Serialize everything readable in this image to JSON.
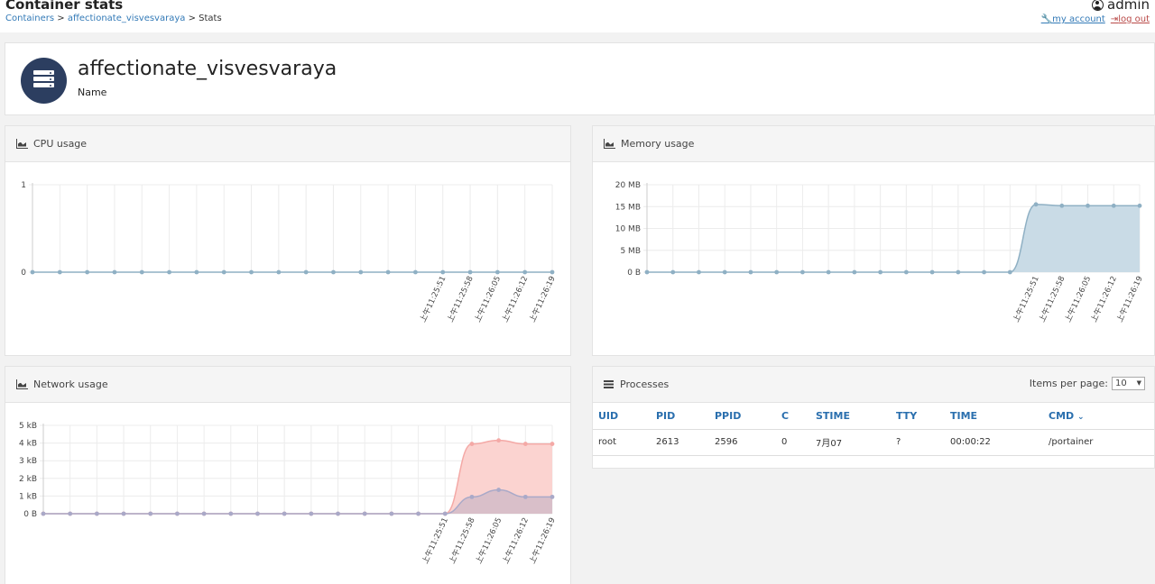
{
  "header": {
    "title": "Container stats",
    "breadcrumb": {
      "containers": "Containers",
      "container": "affectionate_visvesvaraya",
      "current": "Stats",
      "sep": ">"
    },
    "user": "admin",
    "my_account": "my account",
    "log_out": "log out"
  },
  "container": {
    "name": "affectionate_visvesvaraya",
    "name_label": "Name",
    "avatar_icon": "server-icon"
  },
  "panels": {
    "cpu": "CPU usage",
    "memory": "Memory usage",
    "network": "Network usage",
    "processes": "Processes"
  },
  "processes": {
    "items_per_page_label": "Items per page:",
    "items_per_page": "10",
    "columns": [
      "UID",
      "PID",
      "PPID",
      "C",
      "STIME",
      "TTY",
      "TIME",
      "CMD"
    ],
    "sort_indicator": "chevron-down-icon",
    "rows": [
      [
        "root",
        "2613",
        "2596",
        "0",
        "7月07",
        "?",
        "00:00:22",
        "/portainer"
      ]
    ]
  },
  "chart_data": [
    {
      "type": "line",
      "title": "CPU usage",
      "yticks": [
        "0",
        "1"
      ],
      "ylim": [
        0,
        1
      ],
      "xticks": [
        "上午11:25:51",
        "上午11:25:58",
        "上午11:26:05",
        "上午11:26:12",
        "上午11:26:19"
      ],
      "series": [
        {
          "values": [
            0,
            0,
            0,
            0,
            0,
            0,
            0,
            0,
            0,
            0,
            0,
            0,
            0,
            0,
            0,
            0,
            0,
            0,
            0,
            0
          ],
          "color": "#8fb0c4"
        }
      ]
    },
    {
      "type": "area",
      "title": "Memory usage",
      "yticks": [
        "0 B",
        "5 MB",
        "10 MB",
        "15 MB",
        "20 MB"
      ],
      "ylim": [
        0,
        20
      ],
      "xticks": [
        "上午11:25:51",
        "上午11:25:58",
        "上午11:26:05",
        "上午11:26:12",
        "上午11:26:19"
      ],
      "series": [
        {
          "values": [
            0,
            0,
            0,
            0,
            0,
            0,
            0,
            0,
            0,
            0,
            0,
            0,
            0,
            0,
            0,
            15.5,
            15.2,
            15.2,
            15.2,
            15.2
          ],
          "color": "#8fb0c4",
          "fill": "#c9dbe6"
        }
      ]
    },
    {
      "type": "area",
      "title": "Network usage",
      "yticks": [
        "0 B",
        "1 kB",
        "2 kB",
        "3 kB",
        "4 kB",
        "5 kB"
      ],
      "ylim": [
        0,
        5
      ],
      "xticks": [
        "上午11:25:51",
        "上午11:25:58",
        "上午11:26:05",
        "上午11:26:12",
        "上午11:26:19"
      ],
      "series": [
        {
          "values": [
            0,
            0,
            0,
            0,
            0,
            0,
            0,
            0,
            0,
            0,
            0,
            0,
            0,
            0,
            0,
            0,
            3.95,
            4.15,
            3.95,
            3.95
          ],
          "color": "#f4a9a6",
          "fill": "#fbd3d0"
        },
        {
          "values": [
            0,
            0,
            0,
            0,
            0,
            0,
            0,
            0,
            0,
            0,
            0,
            0,
            0,
            0,
            0,
            0,
            0.95,
            1.35,
            0.95,
            0.95
          ],
          "color": "#a9a9c8",
          "fill": "rgba(190,175,195,0.55)"
        }
      ]
    }
  ]
}
